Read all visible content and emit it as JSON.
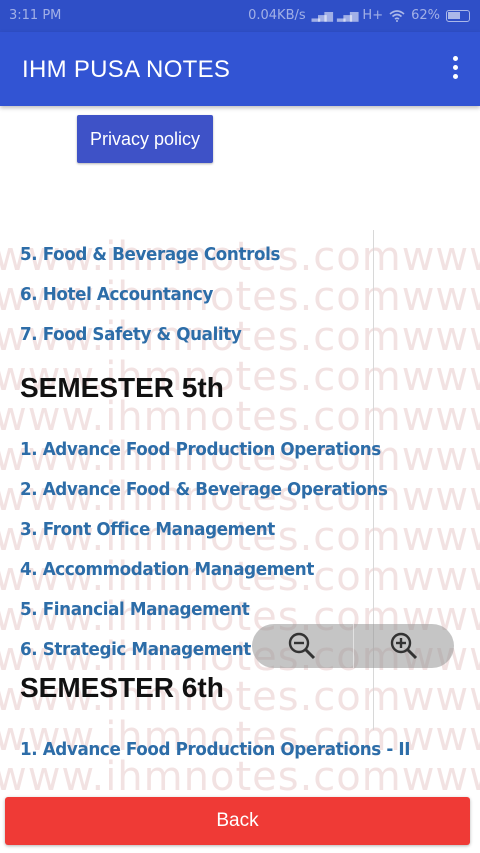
{
  "status_bar": {
    "time": "3:11 PM",
    "network_speed": "0.04KB/s",
    "network_type": "H+",
    "battery_percent": "62%"
  },
  "app_bar": {
    "title": "IHM PUSA NOTES",
    "menu_icon": "more-vert-icon"
  },
  "privacy_button_label": "Privacy policy",
  "watermark_text": "www.ihmnotes.comwww.ihmnotes.com",
  "notes": {
    "prev_items": [
      "5. Food & Beverage Controls",
      "6. Hotel Accountancy",
      "7. Food Safety & Quality"
    ],
    "semester5": {
      "heading": "SEMESTER 5th",
      "items": [
        "1. Advance Food Production Operations",
        "2. Advance Food & Beverage Operations",
        "3. Front Office Management",
        "4. Accommodation Management",
        "5. Financial Management",
        "6. Strategic Management"
      ]
    },
    "semester6": {
      "heading": "SEMESTER 6th",
      "items": [
        "1. Advance Food Production Operations - II"
      ]
    }
  },
  "zoom": {
    "out_icon": "zoom-out-icon",
    "in_icon": "zoom-in-icon"
  },
  "back_button_label": "Back",
  "colors": {
    "app_bar": "#3254d3",
    "link": "#2d6da8",
    "back_button": "#ef3a36"
  }
}
